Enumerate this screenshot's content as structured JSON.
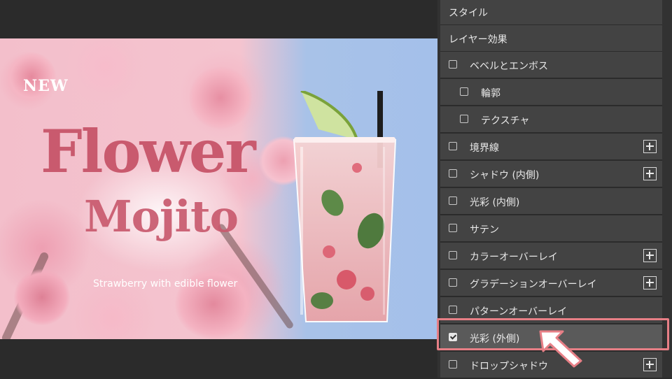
{
  "artwork": {
    "new_label": "NEW",
    "title_line1": "Flower",
    "title_line2": "Mojito",
    "subtitle": "Strawberry with edible flower"
  },
  "panel": {
    "style_header": "スタイル",
    "layer_effects_header": "レイヤー効果",
    "effects": [
      {
        "label": "ベベルとエンボス",
        "checked": false,
        "plus": false
      },
      {
        "label": "輪郭",
        "checked": false,
        "plus": false
      },
      {
        "label": "テクスチャ",
        "checked": false,
        "plus": false
      },
      {
        "label": "境界線",
        "checked": false,
        "plus": true
      },
      {
        "label": "シャドウ (内側)",
        "checked": false,
        "plus": true
      },
      {
        "label": "光彩 (内側)",
        "checked": false,
        "plus": false
      },
      {
        "label": "サテン",
        "checked": false,
        "plus": false
      },
      {
        "label": "カラーオーバーレイ",
        "checked": false,
        "plus": true
      },
      {
        "label": "グラデーションオーバーレイ",
        "checked": false,
        "plus": true
      },
      {
        "label": "パターンオーバーレイ",
        "checked": false,
        "plus": false
      },
      {
        "label": "光彩 (外側)",
        "checked": true,
        "plus": false
      },
      {
        "label": "ドロップシャドウ",
        "checked": false,
        "plus": true
      }
    ]
  },
  "colors": {
    "title_pink": "#c95a6e",
    "highlight": "#e77f86",
    "panel_row": "#434343"
  }
}
